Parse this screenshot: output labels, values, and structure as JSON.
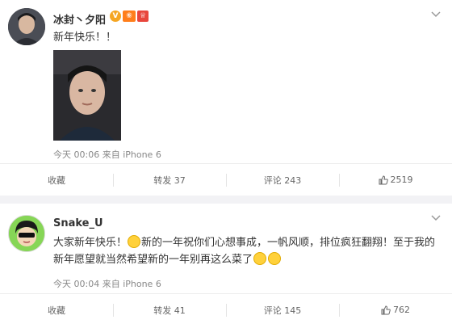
{
  "post1": {
    "author": "冰封丶夕阳",
    "badges": {
      "v": "V",
      "lv": "⑥",
      "vip": "♕"
    },
    "text": "新年快乐！！",
    "meta": "今天 00:06 来自 iPhone 6",
    "actions": {
      "favorite": "收藏",
      "repost": "转发 37",
      "comment": "评论 243",
      "like": "2519"
    }
  },
  "post2": {
    "author": "Snake_U",
    "text_line1": "大家新年快乐！",
    "text_line2": "新的一年祝你们心想事成，一帆风顺，排位疯狂翻翔！至于我的",
    "text_line3": "新年愿望就当然希望新的一年别再这么菜了",
    "meta": "今天 00:04 来自 iPhone 6",
    "actions": {
      "favorite": "收藏",
      "repost": "转发 41",
      "comment": "评论 145",
      "like": "762"
    }
  },
  "icons": {
    "chevron": "chevron-down-icon",
    "like": "thumbs-up-icon",
    "emoji_smile": "smile-emoji-icon",
    "emoji_cry": "cry-emoji-icon"
  },
  "colors": {
    "text": "#333333",
    "meta": "#888888",
    "divider": "#ececec",
    "gap": "#f2f2f5"
  }
}
